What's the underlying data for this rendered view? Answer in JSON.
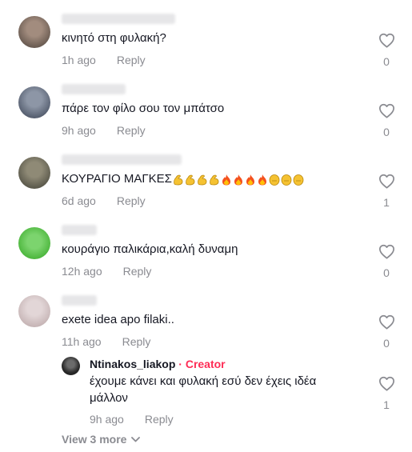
{
  "comments": [
    {
      "text": "κινητό στη φυλακή?",
      "time": "1h ago",
      "reply": "Reply",
      "likes": "0",
      "avatar_color": "#7d6f66"
    },
    {
      "text": "πάρε τον φίλο σου τον μπάτσο",
      "time": "9h ago",
      "reply": "Reply",
      "likes": "0",
      "avatar_color": "#6a7487"
    },
    {
      "text": "ΚΟΥΡΑΓΙΟ ΜΑΓΚΕΣ",
      "emojis": [
        "flexed-biceps",
        "flexed-biceps",
        "flexed-biceps",
        "flexed-biceps",
        "fire",
        "fire",
        "fire",
        "fire",
        "face",
        "face",
        "face"
      ],
      "time": "6d ago",
      "reply": "Reply",
      "likes": "1",
      "avatar_color": "#6b6a5c"
    },
    {
      "text": "κουράγιο παλικάρια,καλή δυναμη",
      "time": "12h ago",
      "reply": "Reply",
      "likes": "0",
      "avatar_color": "#5cc24d"
    },
    {
      "text": "exete idea apo filaki..",
      "time": "11h ago",
      "reply": "Reply",
      "likes": "0",
      "avatar_color": "#cdbfc0"
    }
  ],
  "reply": {
    "author": "Ntinakos_liakop",
    "separator": "·",
    "badge": "Creator",
    "text_line1": "έχουμε κάνει και φυλακή εσύ δεν έχεις ιδέα",
    "text_line2": "μάλλον",
    "time": "9h ago",
    "reply": "Reply",
    "likes": "1"
  },
  "view_more": "View 3 more",
  "colors": {
    "text": "#161823",
    "muted": "#8a8b91",
    "creator": "#fe2c55",
    "heart_outline": "#8a8b91"
  }
}
